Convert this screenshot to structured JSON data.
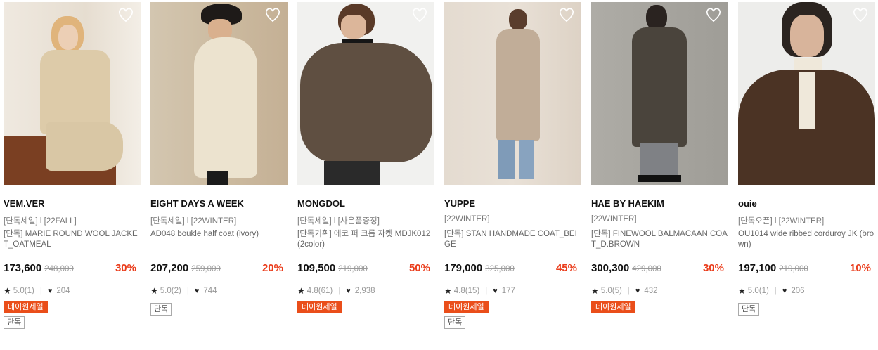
{
  "products": [
    {
      "brand": "VEM.VER",
      "sub": "[단독세일] l [22FALL]",
      "name": "[단독] MARIE ROUND WOOL JACKET_OATMEAL",
      "price": "173,600",
      "original_price": "248,000",
      "discount": "30%",
      "rating": "5.0(1)",
      "likes": "204",
      "badges": [
        "데이원세일",
        "단독"
      ],
      "image_palette": [
        "#e9e1d6",
        "#d8c4a3"
      ]
    },
    {
      "brand": "EIGHT DAYS A WEEK",
      "sub": "[단독세일] l [22WINTER]",
      "name": "AD048 boukle half coat (ivory)",
      "price": "207,200",
      "original_price": "259,000",
      "discount": "20%",
      "rating": "5.0(2)",
      "likes": "744",
      "badges": [
        "단독"
      ],
      "image_palette": [
        "#cfc1a9",
        "#efe6d4"
      ]
    },
    {
      "brand": "MONGDOL",
      "sub": "[단독세일] l [사은품증정]",
      "name": "[단독기획] 에코 퍼 크롭 자켓 MDJK012 (2color)",
      "price": "109,500",
      "original_price": "219,000",
      "discount": "50%",
      "rating": "4.8(61)",
      "likes": "2,938",
      "badges": [
        "데이원세일"
      ],
      "image_palette": [
        "#f2f2f0",
        "#5e4e40"
      ]
    },
    {
      "brand": "YUPPE",
      "sub": "[22WINTER]",
      "name": "[단독] STAN HANDMADE COAT_BEIGE",
      "price": "179,000",
      "original_price": "325,000",
      "discount": "45%",
      "rating": "4.8(15)",
      "likes": "177",
      "badges": [
        "데이원세일",
        "단독"
      ],
      "image_palette": [
        "#e6ddd3",
        "#b9a590"
      ]
    },
    {
      "brand": "HAE BY HAEKIM",
      "sub": "[22WINTER]",
      "name": "[단독] FINEWOOL BALMACAAN COAT_D.BROWN",
      "price": "300,300",
      "original_price": "429,000",
      "discount": "30%",
      "rating": "5.0(5)",
      "likes": "432",
      "badges": [
        "데이원세일"
      ],
      "image_palette": [
        "#a7a59f",
        "#3e3a34"
      ]
    },
    {
      "brand": "ouie",
      "sub": "[단독오픈] l [22WINTER]",
      "name": "OU1014 wide ribbed corduroy JK (brown)",
      "price": "197,100",
      "original_price": "219,000",
      "discount": "10%",
      "rating": "5.0(1)",
      "likes": "206",
      "badges": [
        "단독"
      ],
      "image_palette": [
        "#eeeeec",
        "#4b3324"
      ]
    }
  ],
  "colors": {
    "discount": "#ea3d1c",
    "sale_badge": "#ea4e1a"
  },
  "icons": {
    "wishlist": "heart-outline-icon",
    "rating": "star-icon",
    "likes": "heart-filled-icon"
  }
}
